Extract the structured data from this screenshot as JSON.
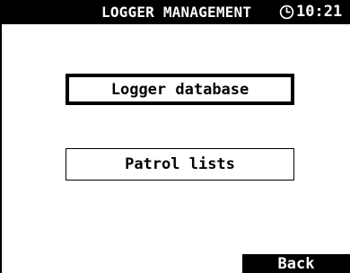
{
  "header": {
    "title": "LOGGER MANAGEMENT",
    "clock_icon": "clock-icon",
    "time": "10:21"
  },
  "menu": {
    "items": [
      {
        "label": "Logger database",
        "selected": true
      },
      {
        "label": "Patrol lists",
        "selected": false
      }
    ]
  },
  "softkeys": {
    "back_label": "Back"
  },
  "colors": {
    "background": "#ffffff",
    "foreground": "#000000"
  }
}
